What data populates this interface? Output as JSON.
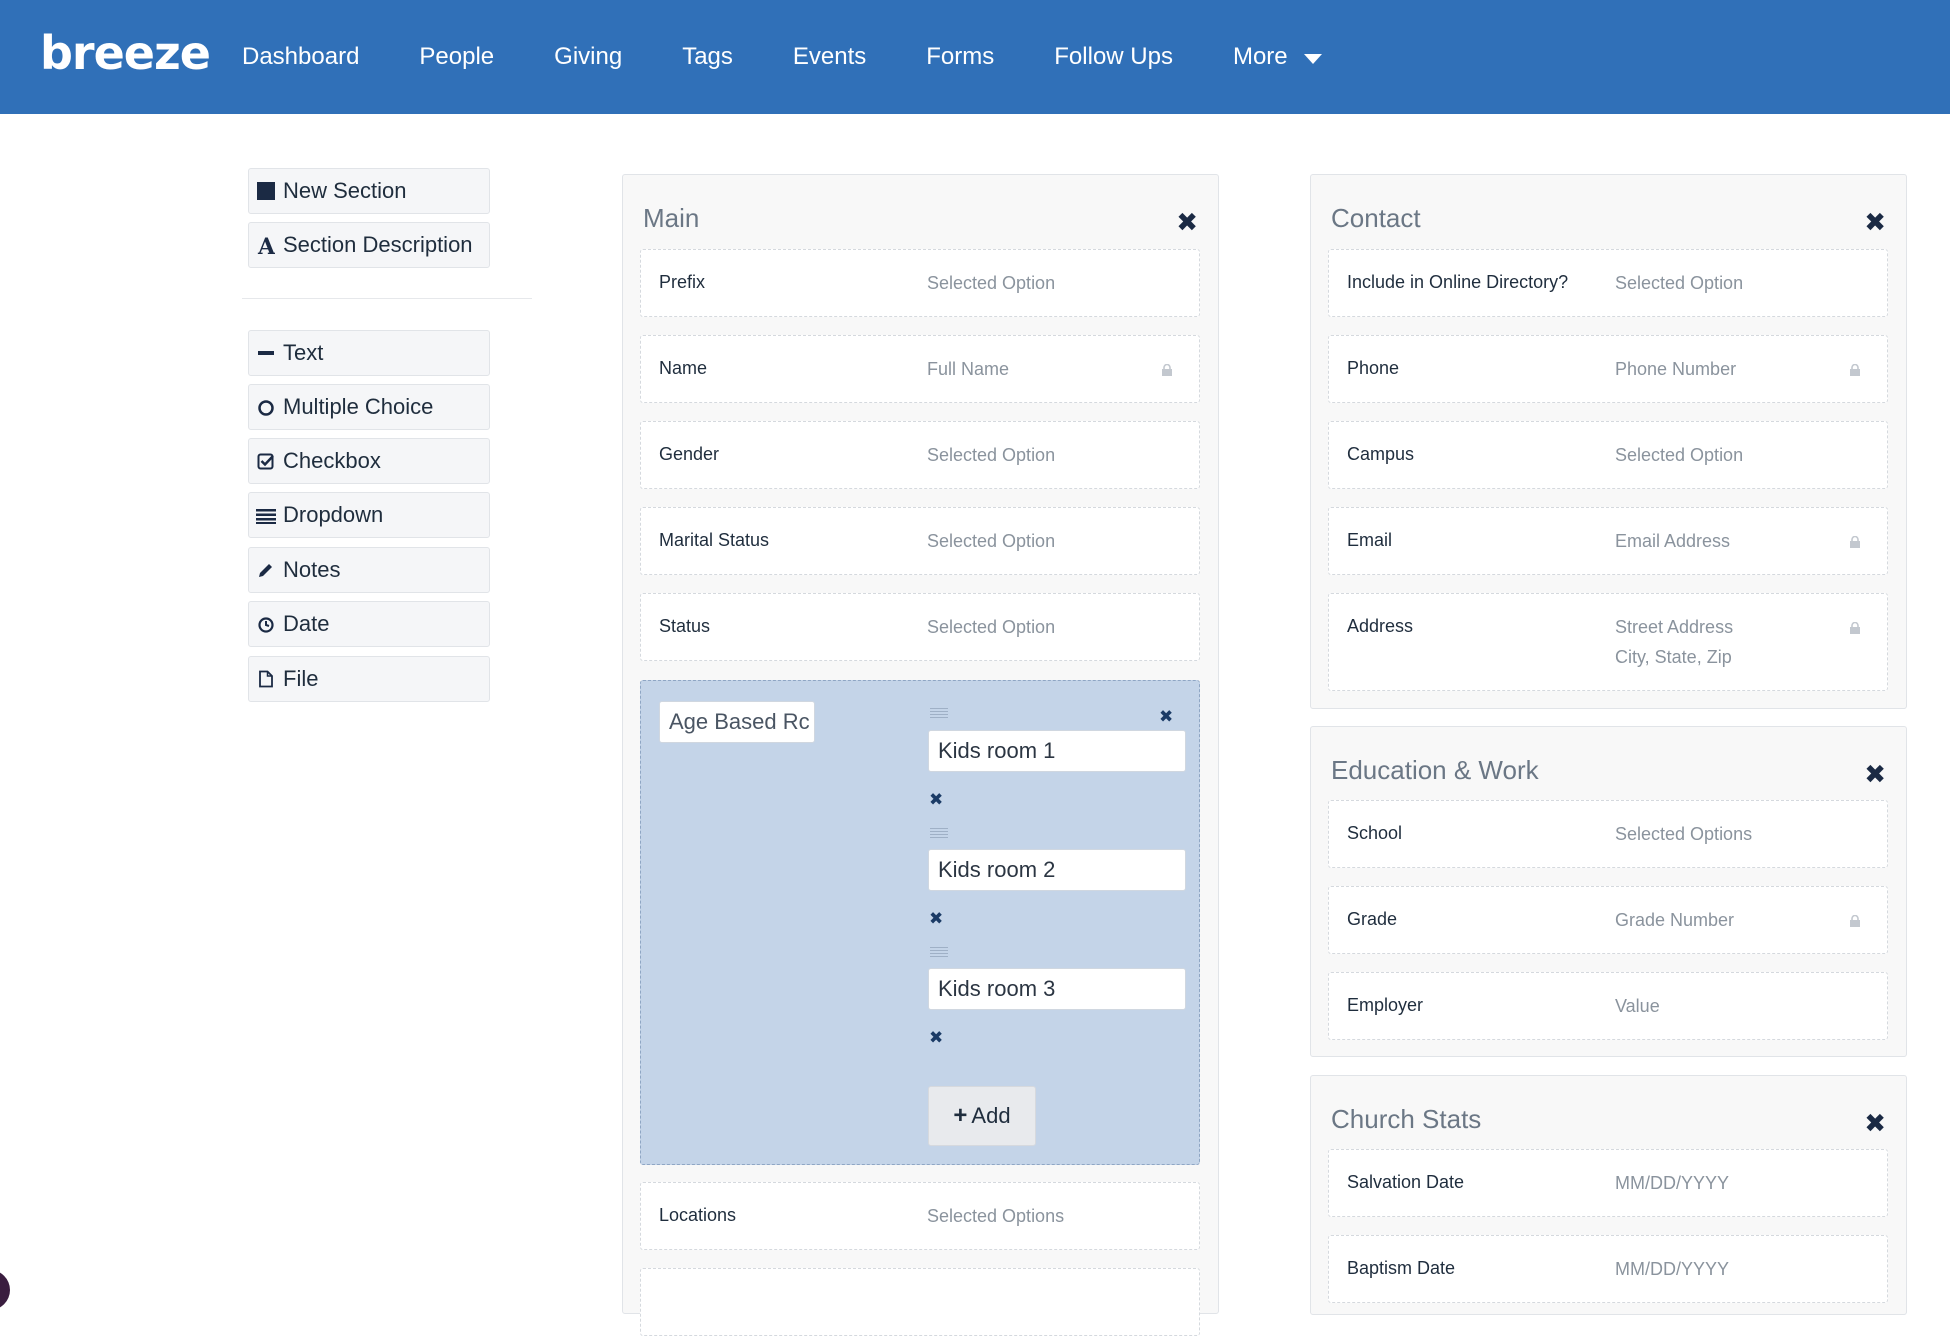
{
  "brand": {
    "logo": "breeze",
    "colors": {
      "nav_bg": "#3070b8",
      "field_group_bg": "#c4d4e8"
    }
  },
  "nav": {
    "items": [
      "Dashboard",
      "People",
      "Giving",
      "Tags",
      "Events",
      "Forms",
      "Follow Ups"
    ],
    "more_label": "More"
  },
  "toolbox": {
    "layout": [
      {
        "icon": "square-icon",
        "label": "New Section"
      },
      {
        "icon": "letter-a-icon",
        "label": "Section Description"
      }
    ],
    "fields": [
      {
        "icon": "dash-icon",
        "label": "Text"
      },
      {
        "icon": "circle-icon",
        "label": "Multiple Choice"
      },
      {
        "icon": "checkbox-icon",
        "label": "Checkbox"
      },
      {
        "icon": "list-icon",
        "label": "Dropdown"
      },
      {
        "icon": "pencil-icon",
        "label": "Notes"
      },
      {
        "icon": "clock-icon",
        "label": "Date"
      },
      {
        "icon": "file-icon",
        "label": "File"
      }
    ]
  },
  "main": {
    "title": "Main",
    "fields": [
      {
        "label": "Prefix",
        "value": "Selected Option",
        "locked": false
      },
      {
        "label": "Name",
        "value": "Full Name",
        "locked": true
      },
      {
        "label": "Gender",
        "value": "Selected Option",
        "locked": false
      },
      {
        "label": "Marital Status",
        "value": "Selected Option",
        "locked": false
      },
      {
        "label": "Status",
        "value": "Selected Option",
        "locked": false
      }
    ],
    "age_based": {
      "name_value": "Age Based Rc",
      "rooms": [
        "Kids room 1",
        "Kids room 2",
        "Kids room 3"
      ],
      "add_label": "Add"
    },
    "after_fields": [
      {
        "label": "Locations",
        "value": "Selected Options",
        "locked": false
      }
    ]
  },
  "contact": {
    "title": "Contact",
    "fields": [
      {
        "label": "Include in Online Directory?",
        "value": "Selected Option",
        "locked": false
      },
      {
        "label": "Phone",
        "value": "Phone Number",
        "locked": true
      },
      {
        "label": "Campus",
        "value": "Selected Option",
        "locked": false
      },
      {
        "label": "Email",
        "value": "Email Address",
        "locked": true
      },
      {
        "label": "Address",
        "value": "Street Address",
        "value2": "City, State, Zip",
        "locked": true
      }
    ]
  },
  "education": {
    "title": "Education & Work",
    "fields": [
      {
        "label": "School",
        "value": "Selected Options",
        "locked": false
      },
      {
        "label": "Grade",
        "value": "Grade Number",
        "locked": true
      },
      {
        "label": "Employer",
        "value": "Value",
        "locked": false
      }
    ]
  },
  "church_stats": {
    "title": "Church Stats",
    "fields": [
      {
        "label": "Salvation Date",
        "value": "MM/DD/YYYY",
        "locked": false
      },
      {
        "label": "Baptism Date",
        "value": "MM/DD/YYYY",
        "locked": false
      }
    ]
  }
}
